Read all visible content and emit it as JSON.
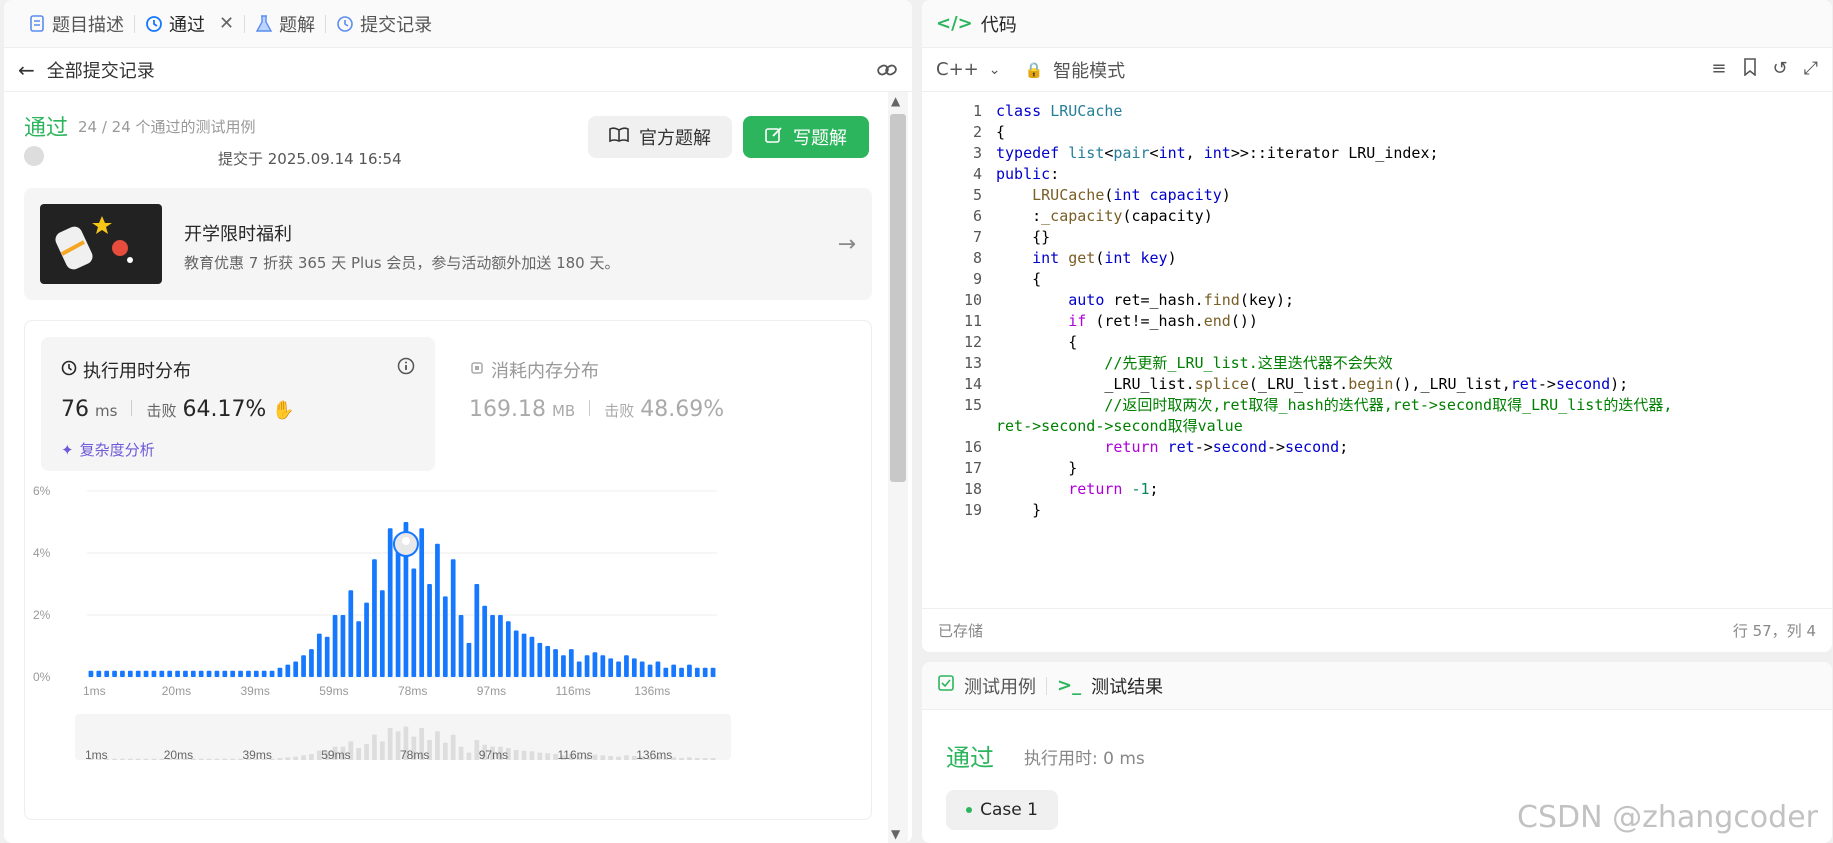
{
  "left_tabs": [
    {
      "label": "题目描述",
      "icon": "document-icon"
    },
    {
      "label": "通过",
      "icon": "history-icon"
    },
    {
      "label": "题解",
      "icon": "flask-icon"
    },
    {
      "label": "提交记录",
      "icon": "history-icon"
    }
  ],
  "subbar": {
    "label": "全部提交记录"
  },
  "submission": {
    "status": "通过",
    "cases": "24 / 24 个通过的测试用例",
    "submit_time": "提交于 2025.09.14 16:54",
    "btn_official": "官方题解",
    "btn_write": "写题解"
  },
  "promo": {
    "title": "开学限时福利",
    "subtitle": "教育优惠 7 折获 365 天 Plus 会员，参与活动额外加送 180 天。"
  },
  "runtime": {
    "title": "执行用时分布",
    "value": "76",
    "unit": "ms",
    "beat_label": "击败",
    "beat_value": "64.17%",
    "complexity_link": "复杂度分析"
  },
  "memory": {
    "title": "消耗内存分布",
    "value": "169.18",
    "unit": "MB",
    "beat_label": "击败",
    "beat_value": "48.69%"
  },
  "chart_data": {
    "type": "bar",
    "y_ticks": [
      "6%",
      "4%",
      "2%",
      "0%"
    ],
    "ylim": [
      0,
      6
    ],
    "x_ticks": [
      "1ms",
      "20ms",
      "39ms",
      "59ms",
      "78ms",
      "97ms",
      "116ms",
      "136ms"
    ],
    "values": [
      0.2,
      0.2,
      0.2,
      0.2,
      0.2,
      0.2,
      0.2,
      0.2,
      0.2,
      0.2,
      0.2,
      0.2,
      0.2,
      0.2,
      0.2,
      0.2,
      0.2,
      0.2,
      0.2,
      0.2,
      0.2,
      0.2,
      0.2,
      0.2,
      0.3,
      0.4,
      0.5,
      0.7,
      0.9,
      1.4,
      1.3,
      2.0,
      2.0,
      2.8,
      1.8,
      2.4,
      3.8,
      2.8,
      4.8,
      4.3,
      5.0,
      3.5,
      4.8,
      3.0,
      4.3,
      2.6,
      3.8,
      2.0,
      1.1,
      3.0,
      2.3,
      2.0,
      2.0,
      1.8,
      1.5,
      1.4,
      1.3,
      1.1,
      1.0,
      0.9,
      0.7,
      0.9,
      0.5,
      0.7,
      0.8,
      0.7,
      0.6,
      0.5,
      0.7,
      0.6,
      0.5,
      0.4,
      0.5,
      0.3,
      0.4,
      0.3,
      0.4,
      0.3,
      0.3,
      0.3
    ],
    "highlight_index": 40,
    "bar_color": "#1677ff"
  },
  "code": {
    "title": "代码",
    "language": "C++",
    "mode": "智能模式",
    "saved": "已存储",
    "cursor": "行 57，列 4",
    "lines": [
      {
        "n": "1",
        "html": "<span class='kw'>class</span> <span class='ty'>LRUCache</span>"
      },
      {
        "n": "2",
        "html": "{"
      },
      {
        "n": "3",
        "html": "<span class='kw'>typedef</span> <span class='ty'>list</span>&lt;<span class='ty'>pair</span>&lt;<span class='kw'>int</span>, <span class='kw'>int</span>&gt;&gt;::iterator LRU_index;"
      },
      {
        "n": "4",
        "html": "<span class='kw'>public</span>:"
      },
      {
        "n": "5",
        "html": "    <span class='fn'>LRUCache</span>(<span class='kw'>int</span> <span class='kw'>capacity</span>)"
      },
      {
        "n": "6",
        "html": "    :<span class='fn'>_capacity</span>(capacity)"
      },
      {
        "n": "7",
        "html": "    {}"
      },
      {
        "n": "8",
        "html": "    <span class='kw'>int</span> <span class='fn'>get</span>(<span class='kw'>int</span> <span class='kw'>key</span>)"
      },
      {
        "n": "9",
        "html": "    {"
      },
      {
        "n": "10",
        "html": "        <span class='kw'>auto</span> ret=_hash.<span class='fn'>find</span>(key);"
      },
      {
        "n": "11",
        "html": "        <span class='rt'>if</span> (ret!=_hash.<span class='fn'>end</span>())"
      },
      {
        "n": "12",
        "html": "        {"
      },
      {
        "n": "13",
        "html": "            <span class='cm'>//先更新_LRU_list.这里迭代器不会失效</span>"
      },
      {
        "n": "14",
        "html": "            _LRU_list.<span class='fn'>splice</span>(_LRU_list.<span class='fn'>begin</span>(),_LRU_list,<span class='kw'>ret</span>-&gt;<span class='kw'>second</span>);"
      },
      {
        "n": "15",
        "html": "            <span class='cm'>//返回时取两次,ret取得_hash的迭代器,ret-&gt;second取得_LRU_list的迭代器,</span>"
      },
      {
        "n": "",
        "html": "<span class='cm'>ret-&gt;second-&gt;second取得value</span>",
        "wrap": true
      },
      {
        "n": "16",
        "html": "            <span class='rt'>return</span> <span class='kw'>ret</span>-&gt;<span class='kw'>second</span>-&gt;<span class='kw'>second</span>;"
      },
      {
        "n": "17",
        "html": "        }"
      },
      {
        "n": "18",
        "html": "        <span class='rt'>return</span> <span class='nm'>-1</span>;"
      },
      {
        "n": "19",
        "html": "    }"
      }
    ]
  },
  "results": {
    "tab_cases": "测试用例",
    "tab_results": "测试结果",
    "status": "通过",
    "time": "执行用时: 0 ms",
    "case_label": "Case 1"
  },
  "watermark": "CSDN @zhangcoder"
}
